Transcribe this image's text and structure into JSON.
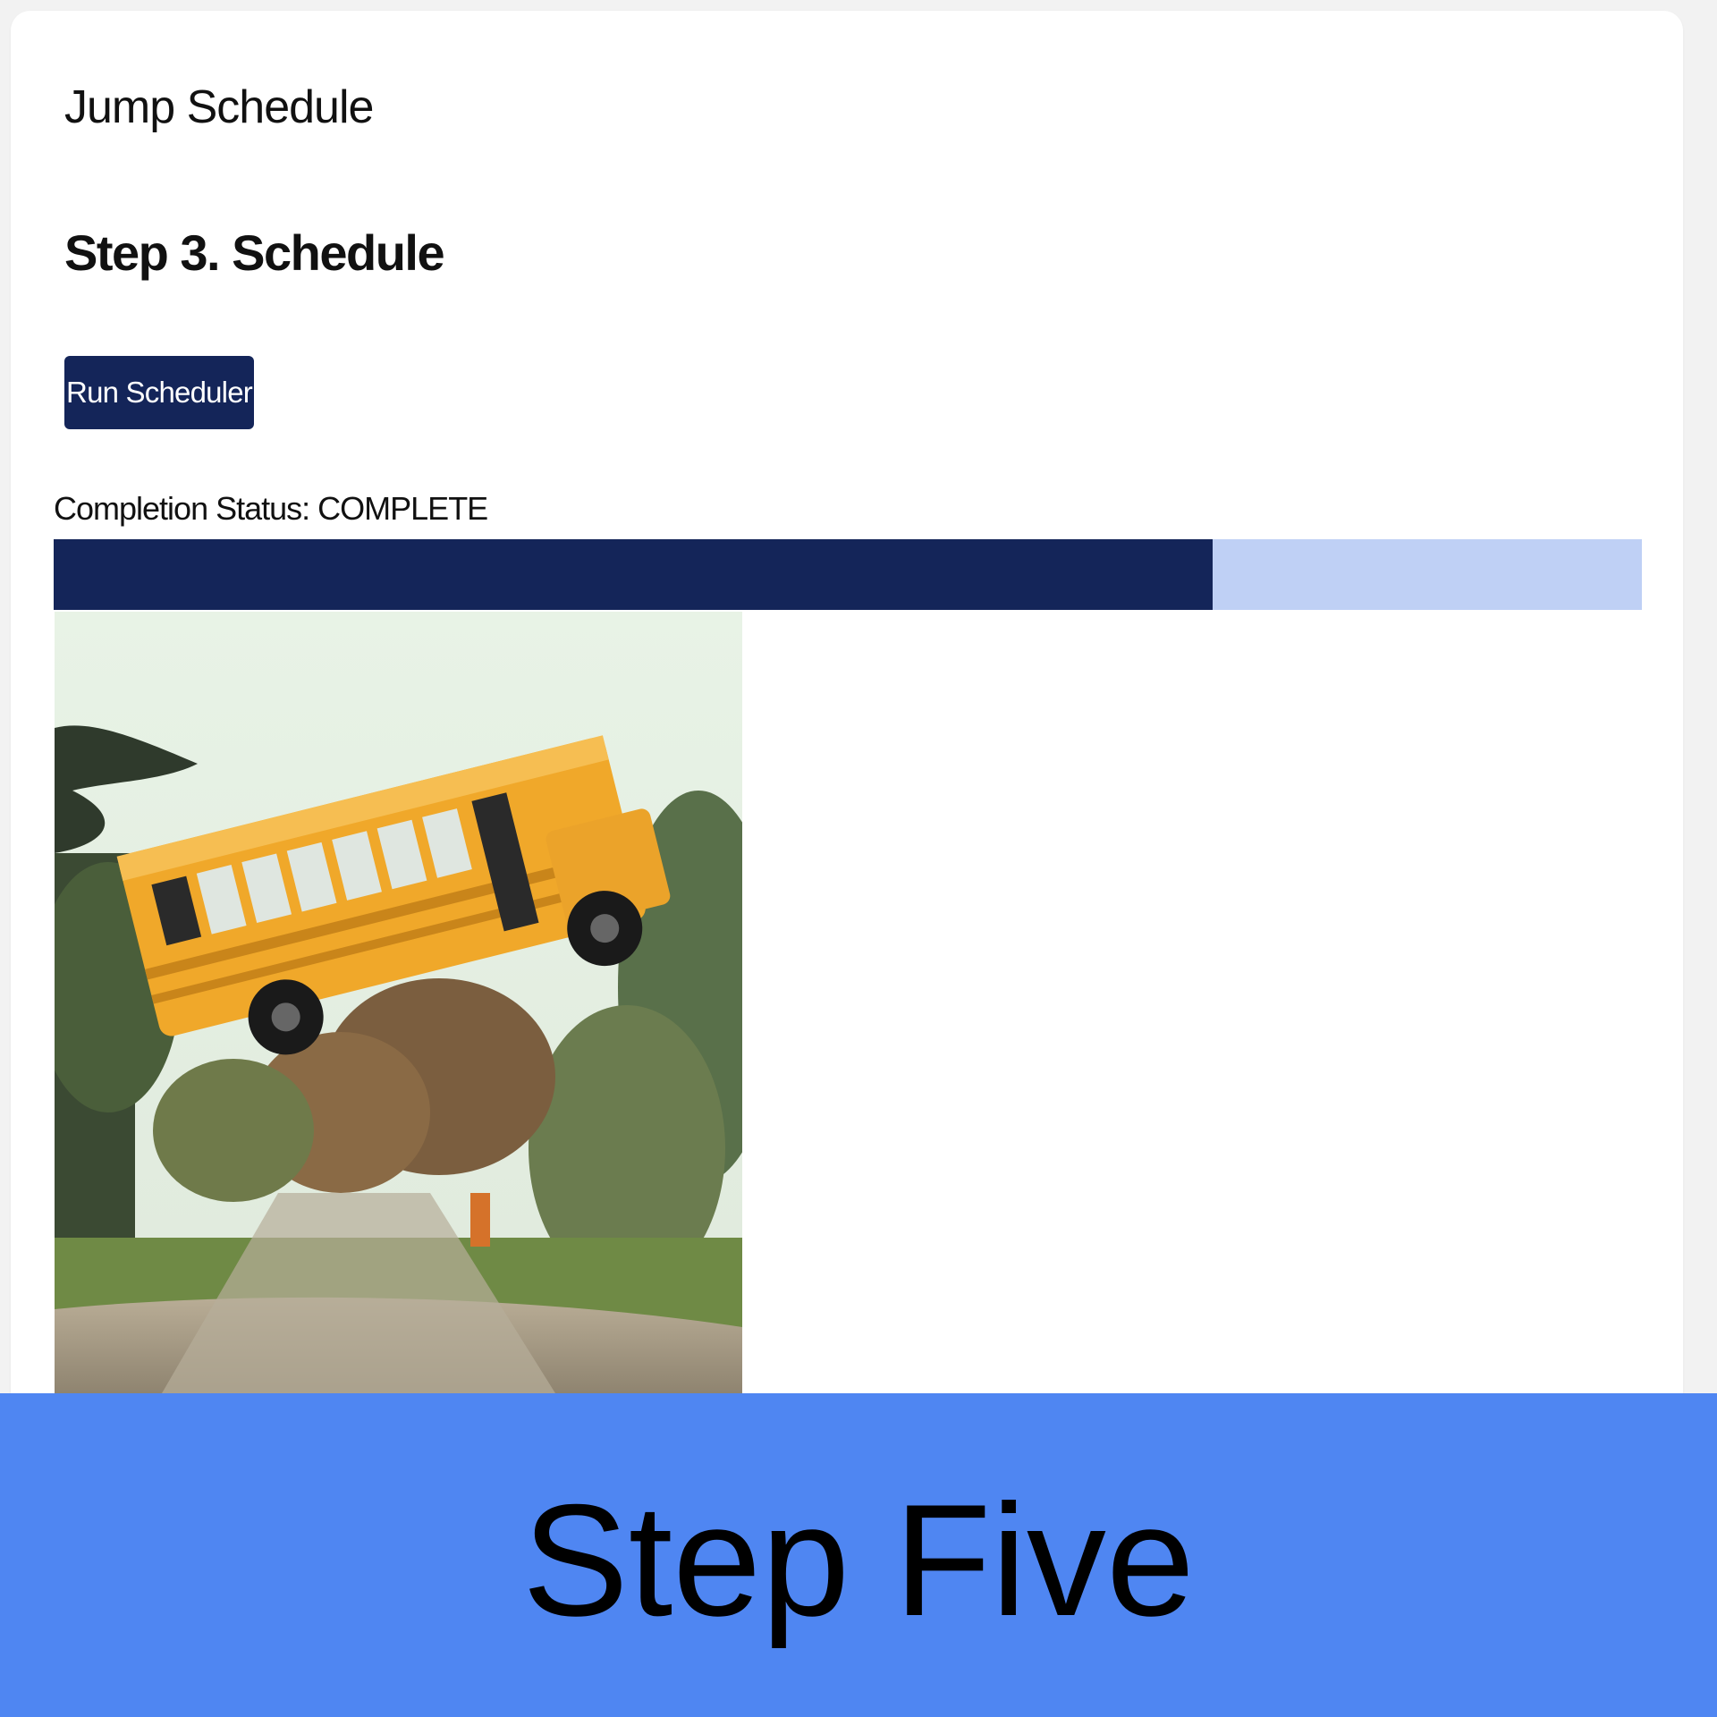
{
  "app": {
    "title": "Jump Schedule"
  },
  "step": {
    "heading": "Step 3. Schedule"
  },
  "actions": {
    "run_button_label": "Run Scheduler"
  },
  "status": {
    "line": "Completion Status: COMPLETE",
    "progress_fraction": 0.73
  },
  "media": {
    "image_name": "flying-school-bus-gif"
  },
  "banner": {
    "text": "Step Five"
  },
  "colors": {
    "accent_dark": "#142559",
    "progress_track": "#bfd0f5",
    "banner_blue": "#4f86f2"
  }
}
